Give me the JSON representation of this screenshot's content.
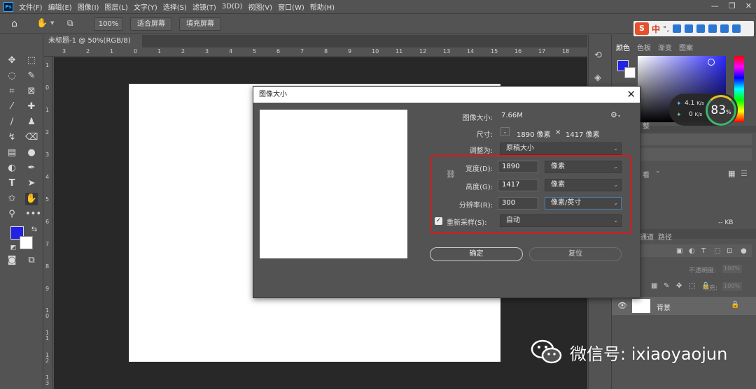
{
  "app": {
    "logo_text": "Ps"
  },
  "menu": [
    "文件(F)",
    "编辑(E)",
    "图像(I)",
    "图层(L)",
    "文字(Y)",
    "选择(S)",
    "滤镜(T)",
    "3D(D)",
    "视图(V)",
    "窗口(W)",
    "帮助(H)"
  ],
  "window_controls": {
    "minimize": "—",
    "restore": "❐",
    "close": "✕"
  },
  "options_bar": {
    "zoom": "100%",
    "fit_screen": "适合屏幕",
    "fill_screen": "填充屏幕"
  },
  "document": {
    "tab_title": "未标题-1 @ 50%(RGB/8)",
    "tab_close": "×"
  },
  "ruler": {
    "top_ticks": [
      "3",
      "2",
      "1",
      "0",
      "1",
      "2",
      "3",
      "4",
      "5",
      "6",
      "7",
      "8",
      "9",
      "10",
      "11",
      "12",
      "13",
      "14",
      "15",
      "16",
      "17",
      "18"
    ],
    "left_ticks": [
      "1",
      "0",
      "1",
      "2",
      "3",
      "4",
      "5",
      "6",
      "7",
      "8",
      "9",
      "1 0",
      "1 1",
      "1 2",
      "1 3"
    ]
  },
  "colors": {
    "foreground": "#2222e6",
    "background": "#ffffff",
    "highlight": "#e01818"
  },
  "panels": {
    "tabs": [
      "颜色",
      "色板",
      "渐变",
      "图案"
    ],
    "lower_tabs": [
      "通道",
      "路径"
    ],
    "opacity_label": "不透明度:",
    "opacity_value": "100%",
    "fill_label": "填充:",
    "fill_value": "100%",
    "size_text": "-- KB",
    "collapsed_label": "整",
    "view_label": "看",
    "layer": {
      "name": "背景"
    }
  },
  "speed_widget": {
    "up": "4.1",
    "up_unit": "K/s",
    "down": "0",
    "down_unit": "K/s",
    "percent": "83",
    "percent_sign": "%"
  },
  "ime": {
    "brand": "S",
    "mode": "中"
  },
  "dialog": {
    "title": "图像大小",
    "close": "✕",
    "image_size_label": "图像大小:",
    "image_size_value": "7.66M",
    "dimensions_label": "尺寸:",
    "dimensions_width": "1890 像素",
    "dimensions_times": "×",
    "dimensions_height": "1417 像素",
    "fit_to_label": "调整为:",
    "fit_to_value": "原稿大小",
    "width_label": "宽度(D):",
    "width_value": "1890",
    "width_unit": "像素",
    "height_label": "高度(G):",
    "height_value": "1417",
    "height_unit": "像素",
    "resolution_label": "分辨率(R):",
    "resolution_value": "300",
    "resolution_unit": "像素/英寸",
    "resample_label": "重新采样(S):",
    "resample_checked": true,
    "resample_value": "自动",
    "ok": "确定",
    "reset": "复位"
  },
  "watermark": {
    "text": "微信号: ixiaoyaojun"
  }
}
